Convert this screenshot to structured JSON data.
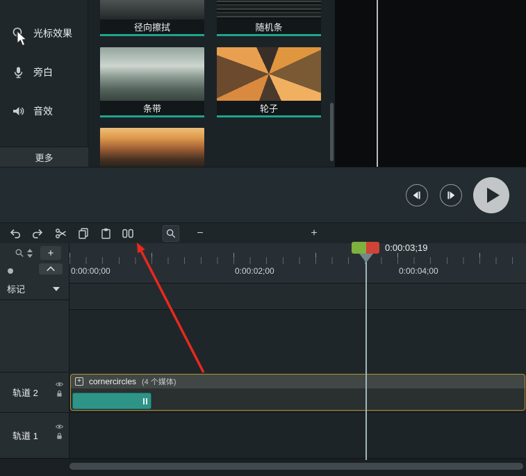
{
  "sidebar": {
    "items": [
      {
        "label": "光标效果"
      },
      {
        "label": "旁白"
      },
      {
        "label": "音效"
      }
    ],
    "more_label": "更多"
  },
  "library": {
    "items": [
      {
        "label": "径向擦拭"
      },
      {
        "label": "随机条"
      },
      {
        "label": "条带"
      },
      {
        "label": "轮子"
      },
      {
        "label": ""
      }
    ]
  },
  "toolbar": {
    "zoom_out_label": "−",
    "zoom_in_label": "+"
  },
  "timeline": {
    "playhead_time": "0:00:03;19",
    "ruler_labels": [
      "0:00:00;00",
      "0:00:02;00",
      "0:00:04;00"
    ],
    "markers_label": "标记",
    "add_track_label": "+",
    "tracks": [
      {
        "label": "轨道 2"
      },
      {
        "label": "轨道 1"
      }
    ],
    "group": {
      "toggle_label": "+",
      "name": "cornercircles",
      "meta": "(4 个媒体)"
    }
  },
  "colors": {
    "accent_teal": "#1fa58e",
    "group_border": "#b2942f",
    "clip_fill": "#2f9488",
    "playhead_green": "#7fb13f",
    "playhead_red": "#cf4436",
    "annotation_red": "#e8291c"
  }
}
